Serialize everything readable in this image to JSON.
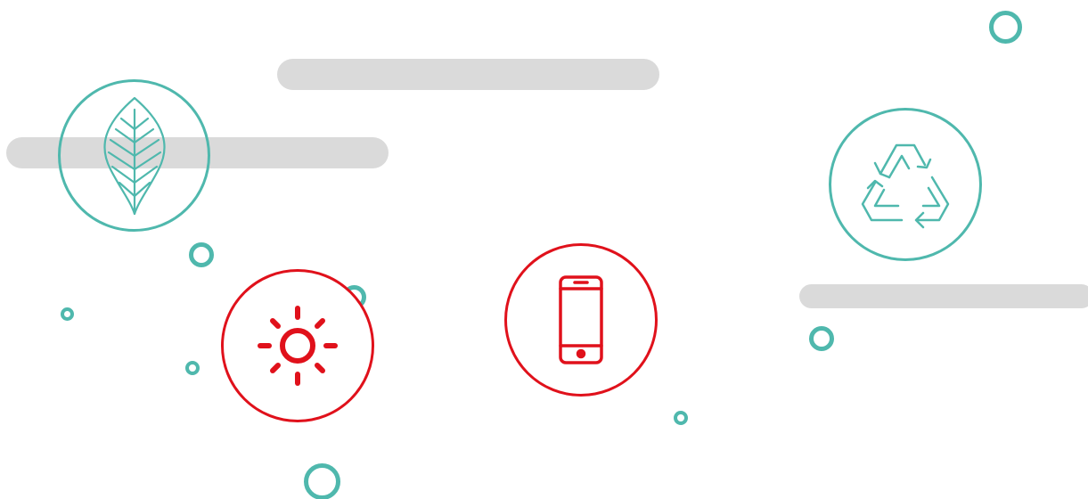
{
  "colors": {
    "teal": "#4fb8ad",
    "red": "#e0111b",
    "bar_gray": "#dadada",
    "background": "#ffffff"
  },
  "icons": [
    "leaf-icon",
    "sun-icon",
    "smartphone-icon",
    "recycle-icon"
  ]
}
